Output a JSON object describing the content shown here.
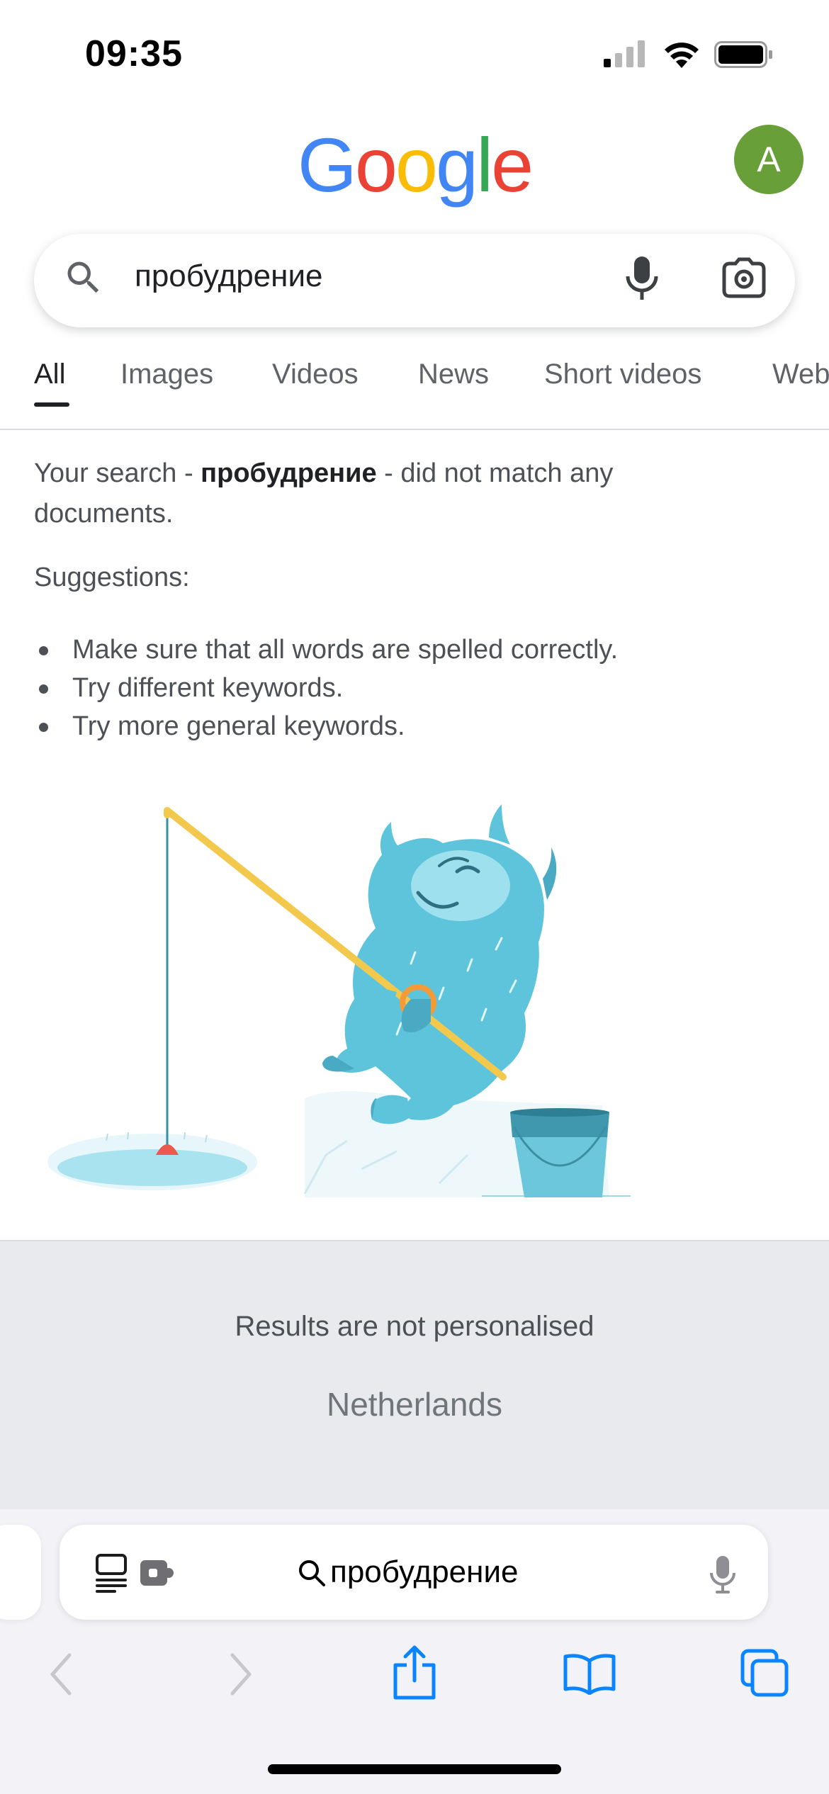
{
  "status_bar": {
    "time": "09:35",
    "icons": [
      "signal-icon",
      "wifi-icon",
      "battery-icon"
    ]
  },
  "header": {
    "logo_letters": [
      {
        "char": "G",
        "color": "#4285F4"
      },
      {
        "char": "o",
        "color": "#EA4335"
      },
      {
        "char": "o",
        "color": "#FBBC05"
      },
      {
        "char": "g",
        "color": "#4285F4"
      },
      {
        "char": "l",
        "color": "#34A853"
      },
      {
        "char": "e",
        "color": "#EA4335"
      }
    ],
    "avatar_initial": "A",
    "avatar_color": "#689f38"
  },
  "search": {
    "query": "пробудрение",
    "icons": [
      "search-icon",
      "mic-icon",
      "lens-icon"
    ]
  },
  "tabs": [
    {
      "label": "All",
      "active": true
    },
    {
      "label": "Images",
      "active": false
    },
    {
      "label": "Videos",
      "active": false
    },
    {
      "label": "News",
      "active": false
    },
    {
      "label": "Short videos",
      "active": false
    },
    {
      "label": "Web",
      "active": false
    }
  ],
  "results": {
    "no_match_prefix": "Your search - ",
    "no_match_query": "пробудрение",
    "no_match_suffix": " - did not match any documents.",
    "suggestions_title": "Suggestions:",
    "suggestions": [
      "Make sure that all words are spelled correctly.",
      "Try different keywords.",
      "Try more general keywords."
    ]
  },
  "footer": {
    "not_personalised": "Results are not personalised",
    "location": "Netherlands"
  },
  "browser": {
    "address_text": "пробудрение",
    "accent_color": "#0a84ff",
    "toolbar_icons": [
      "back-icon",
      "forward-icon",
      "share-icon",
      "bookmarks-icon",
      "tabs-icon"
    ]
  }
}
